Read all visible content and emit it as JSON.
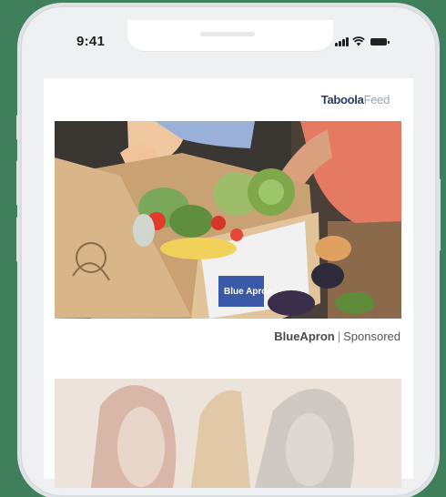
{
  "status_bar": {
    "time": "9:41"
  },
  "feed": {
    "brand": "Taboola",
    "brand_suffix": "Feed"
  },
  "cards": [
    {
      "advertiser": "BlueApron",
      "separator": "|",
      "label": "Sponsored",
      "box_print": "Blue Apron"
    }
  ],
  "colors": {
    "background": "#3f7f5c",
    "phone_frame": "#eef0f2",
    "brand": "#2b3a67"
  }
}
